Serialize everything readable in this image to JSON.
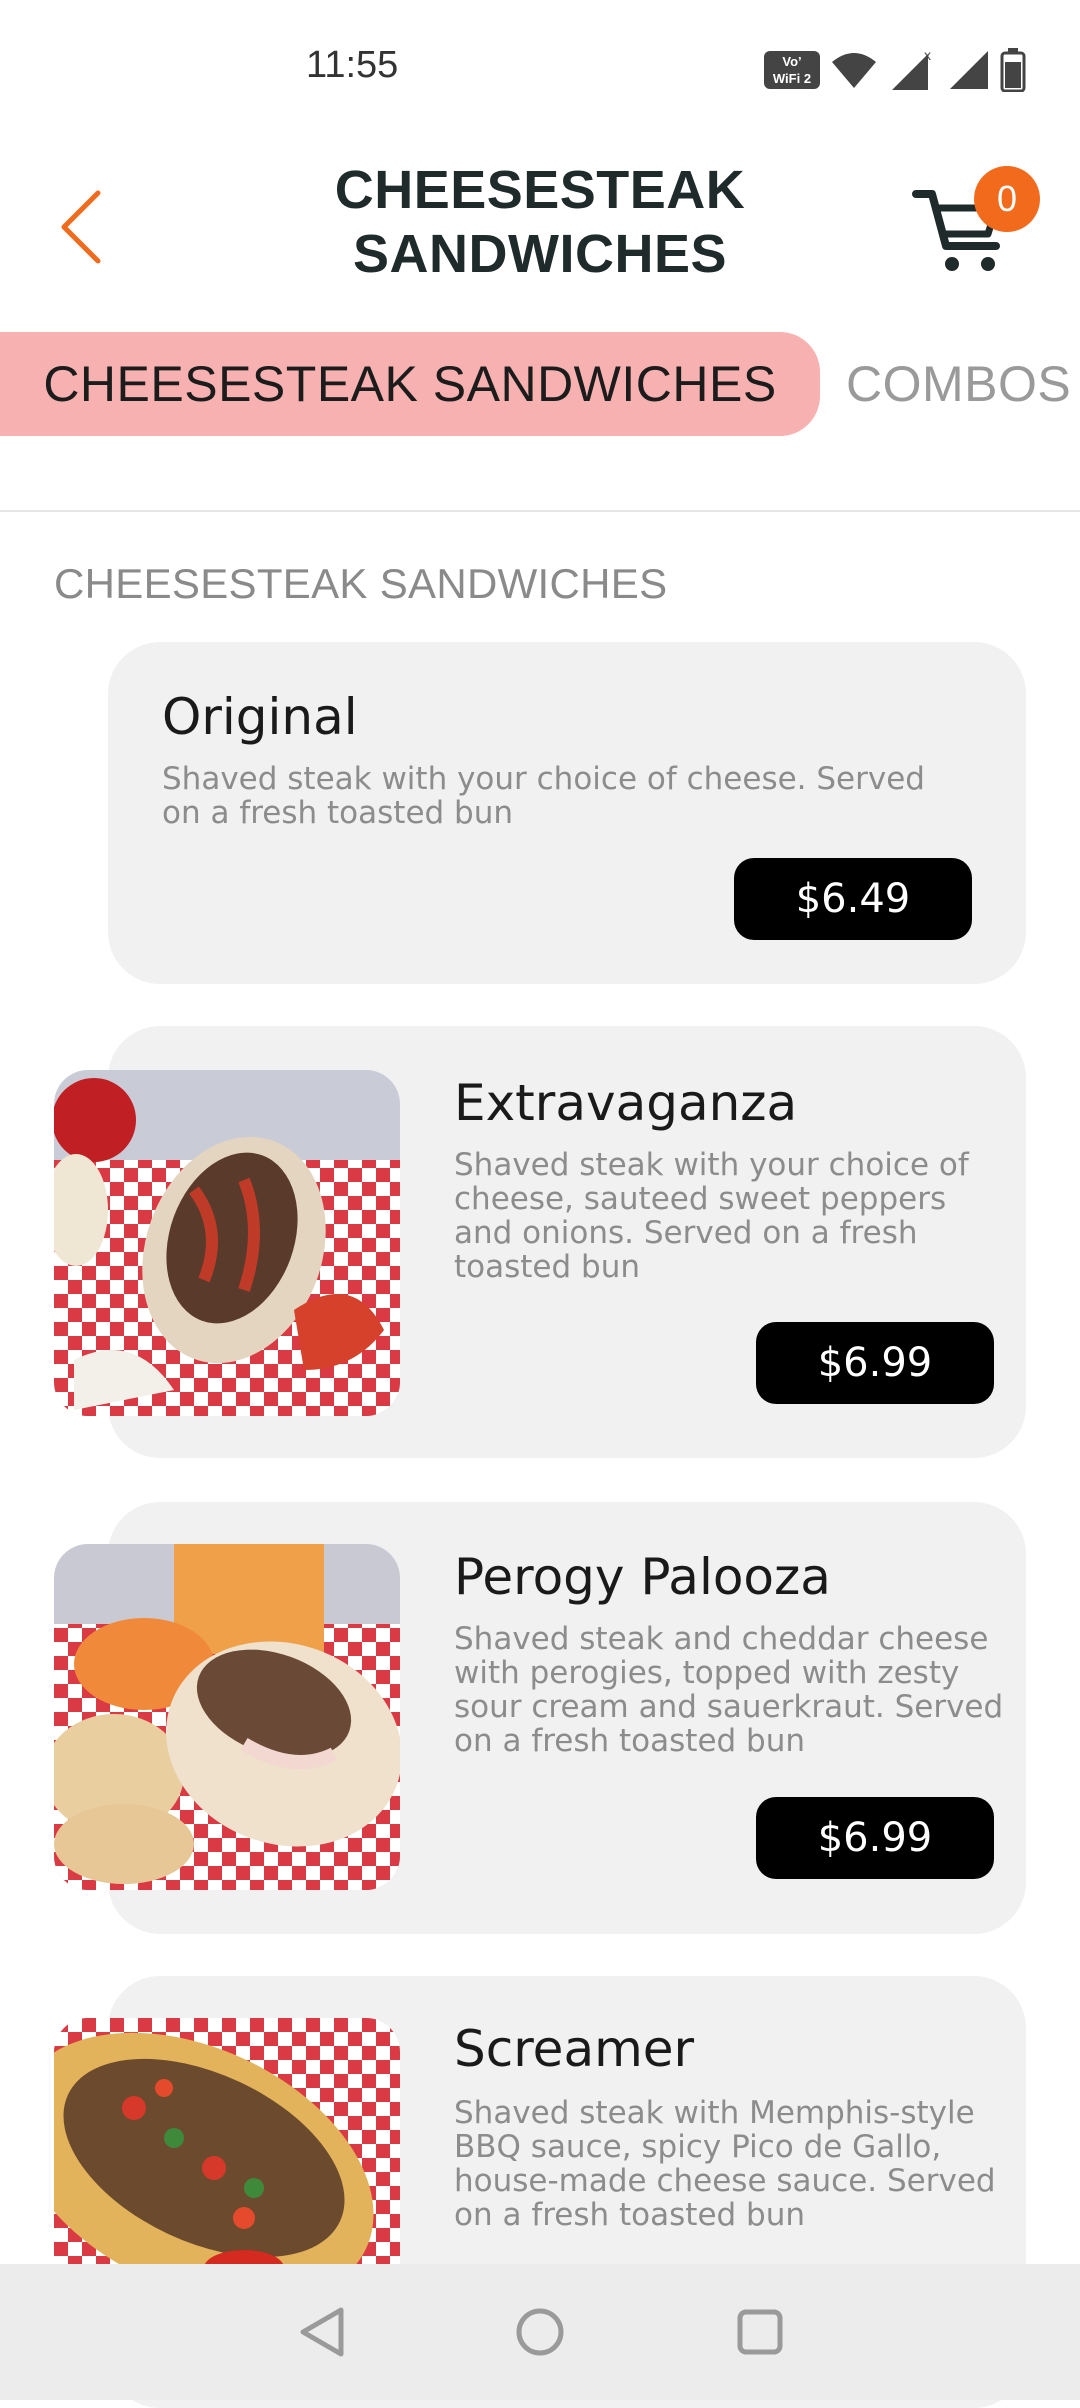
{
  "status_bar": {
    "time": "11:55",
    "volte_line1": "Vo’",
    "volte_line2": "WiFi 2",
    "icons": [
      "volte-wifi-icon",
      "wifi-icon",
      "cellular-signal-x-icon",
      "cellular-signal-icon",
      "battery-icon"
    ]
  },
  "header": {
    "title_line1": "CHEESESTEAK",
    "title_line2": "SANDWICHES",
    "back_icon": "chevron-left-icon",
    "cart_icon": "shopping-cart-icon",
    "cart_count": "0",
    "accent_color": "#f26b1d"
  },
  "tabs": [
    {
      "label": "CHEESESTEAK SANDWICHES",
      "active": true
    },
    {
      "label": "COMBOS",
      "active": false
    }
  ],
  "section_title": "CHEESESTEAK SANDWICHES",
  "menu_items": [
    {
      "name": "Original",
      "description": "Shaved steak with your choice of cheese. Served on a fresh toasted bun",
      "price": "$6.49"
    },
    {
      "name": "Extravaganza",
      "description": "Shaved steak with your choice of cheese, sauteed sweet peppers and onions. Served on a fresh toasted bun",
      "price": "$6.99"
    },
    {
      "name": "Perogy Palooza",
      "description": "Shaved steak and cheddar cheese with perogies, topped with zesty sour cream and sauerkraut. Served on a fresh toasted bun",
      "price": "$6.99"
    },
    {
      "name": "Screamer",
      "description": "Shaved steak with Memphis-style BBQ sauce, spicy Pico de Gallo, house-made cheese sauce. Served on a fresh toasted bun"
    }
  ],
  "nav_bar": {
    "icons": [
      "back-triangle-icon",
      "home-circle-icon",
      "recents-square-icon"
    ]
  }
}
